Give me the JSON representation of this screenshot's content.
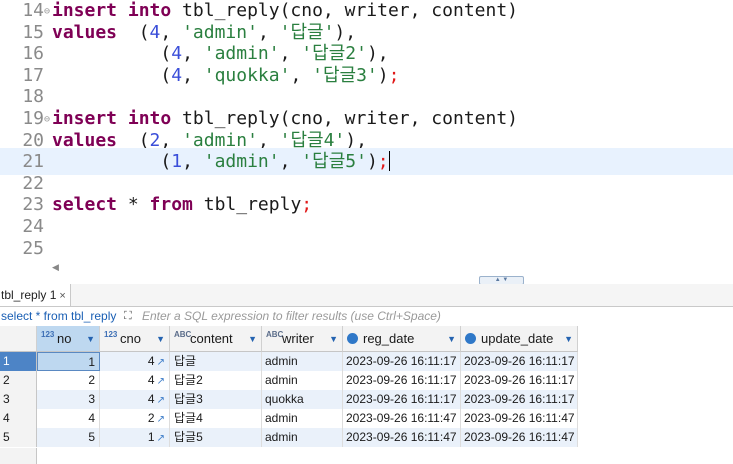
{
  "editor": {
    "lines": [
      {
        "num": "14",
        "fold": "⊖",
        "tokens": [
          {
            "t": "insert into",
            "c": "kw"
          },
          {
            "t": " tbl_reply(cno, writer, content)",
            "c": ""
          }
        ]
      },
      {
        "num": "15",
        "fold": "",
        "tokens": [
          {
            "t": "values",
            "c": "kw"
          },
          {
            "t": "  (",
            "c": ""
          },
          {
            "t": "4",
            "c": "num"
          },
          {
            "t": ", ",
            "c": ""
          },
          {
            "t": "'admin'",
            "c": "str"
          },
          {
            "t": ", ",
            "c": ""
          },
          {
            "t": "'답글'",
            "c": "str"
          },
          {
            "t": "),",
            "c": ""
          }
        ]
      },
      {
        "num": "16",
        "fold": "",
        "tokens": [
          {
            "t": "          (",
            "c": ""
          },
          {
            "t": "4",
            "c": "num"
          },
          {
            "t": ", ",
            "c": ""
          },
          {
            "t": "'admin'",
            "c": "str"
          },
          {
            "t": ", ",
            "c": ""
          },
          {
            "t": "'답글2'",
            "c": "str"
          },
          {
            "t": "),",
            "c": ""
          }
        ]
      },
      {
        "num": "17",
        "fold": "",
        "tokens": [
          {
            "t": "          (",
            "c": ""
          },
          {
            "t": "4",
            "c": "num"
          },
          {
            "t": ", ",
            "c": ""
          },
          {
            "t": "'quokka'",
            "c": "str"
          },
          {
            "t": ", ",
            "c": ""
          },
          {
            "t": "'답글3'",
            "c": "str"
          },
          {
            "t": ")",
            "c": ""
          },
          {
            "t": ";",
            "c": "semi"
          }
        ]
      },
      {
        "num": "18",
        "fold": "",
        "tokens": []
      },
      {
        "num": "19",
        "fold": "⊖",
        "tokens": [
          {
            "t": "insert into",
            "c": "kw"
          },
          {
            "t": " tbl_reply(cno, writer, content)",
            "c": ""
          }
        ]
      },
      {
        "num": "20",
        "fold": "",
        "tokens": [
          {
            "t": "values",
            "c": "kw"
          },
          {
            "t": "  (",
            "c": ""
          },
          {
            "t": "2",
            "c": "num"
          },
          {
            "t": ", ",
            "c": ""
          },
          {
            "t": "'admin'",
            "c": "str"
          },
          {
            "t": ", ",
            "c": ""
          },
          {
            "t": "'답글4'",
            "c": "str"
          },
          {
            "t": "),",
            "c": ""
          }
        ]
      },
      {
        "num": "21",
        "fold": "",
        "current": true,
        "tokens": [
          {
            "t": "          (",
            "c": ""
          },
          {
            "t": "1",
            "c": "num"
          },
          {
            "t": ", ",
            "c": ""
          },
          {
            "t": "'admin'",
            "c": "str"
          },
          {
            "t": ", ",
            "c": ""
          },
          {
            "t": "'답글5'",
            "c": "str"
          },
          {
            "t": ")",
            "c": ""
          },
          {
            "t": ";",
            "c": "semi"
          }
        ]
      },
      {
        "num": "22",
        "fold": "",
        "tokens": []
      },
      {
        "num": "23",
        "fold": "",
        "tokens": [
          {
            "t": "select",
            "c": "kw"
          },
          {
            "t": " * ",
            "c": ""
          },
          {
            "t": "from",
            "c": "kw"
          },
          {
            "t": " tbl_reply",
            "c": ""
          },
          {
            "t": ";",
            "c": "semi"
          }
        ]
      },
      {
        "num": "24",
        "fold": "",
        "tokens": []
      },
      {
        "num": "25",
        "fold": "",
        "tokens": []
      }
    ],
    "scroll_left_glyph": "◀",
    "sash_glyph": "▲ ▼"
  },
  "results": {
    "tab_label": "tbl_reply 1",
    "tab_close": "×",
    "filter_query": "select * from tbl_reply",
    "filter_icon_glyph": "⛶",
    "filter_placeholder": "Enter a SQL expression to filter results (use Ctrl+Space)",
    "columns": [
      {
        "key": "no",
        "label": "no",
        "type": "123"
      },
      {
        "key": "cno",
        "label": "cno",
        "type": "123"
      },
      {
        "key": "content",
        "label": "content",
        "type": "ABC"
      },
      {
        "key": "writer",
        "label": "writer",
        "type": "ABC"
      },
      {
        "key": "reg",
        "label": "reg_date",
        "type": "clock"
      },
      {
        "key": "upd",
        "label": "update_date",
        "type": "clock"
      }
    ],
    "rows": [
      {
        "rn": "1",
        "no": "1",
        "cno": "4",
        "content": "답글",
        "writer": "admin",
        "reg": "2023-09-26 16:11:17",
        "upd": "2023-09-26 16:11:17"
      },
      {
        "rn": "2",
        "no": "2",
        "cno": "4",
        "content": "답글2",
        "writer": "admin",
        "reg": "2023-09-26 16:11:17",
        "upd": "2023-09-26 16:11:17"
      },
      {
        "rn": "3",
        "no": "3",
        "cno": "4",
        "content": "답글3",
        "writer": "quokka",
        "reg": "2023-09-26 16:11:17",
        "upd": "2023-09-26 16:11:17"
      },
      {
        "rn": "4",
        "no": "4",
        "cno": "2",
        "content": "답글4",
        "writer": "admin",
        "reg": "2023-09-26 16:11:47",
        "upd": "2023-09-26 16:11:47"
      },
      {
        "rn": "5",
        "no": "5",
        "cno": "1",
        "content": "답글5",
        "writer": "admin",
        "reg": "2023-09-26 16:11:47",
        "upd": "2023-09-26 16:11:47"
      }
    ],
    "fk_link_glyph": "↗",
    "sort_glyph": "▼"
  }
}
